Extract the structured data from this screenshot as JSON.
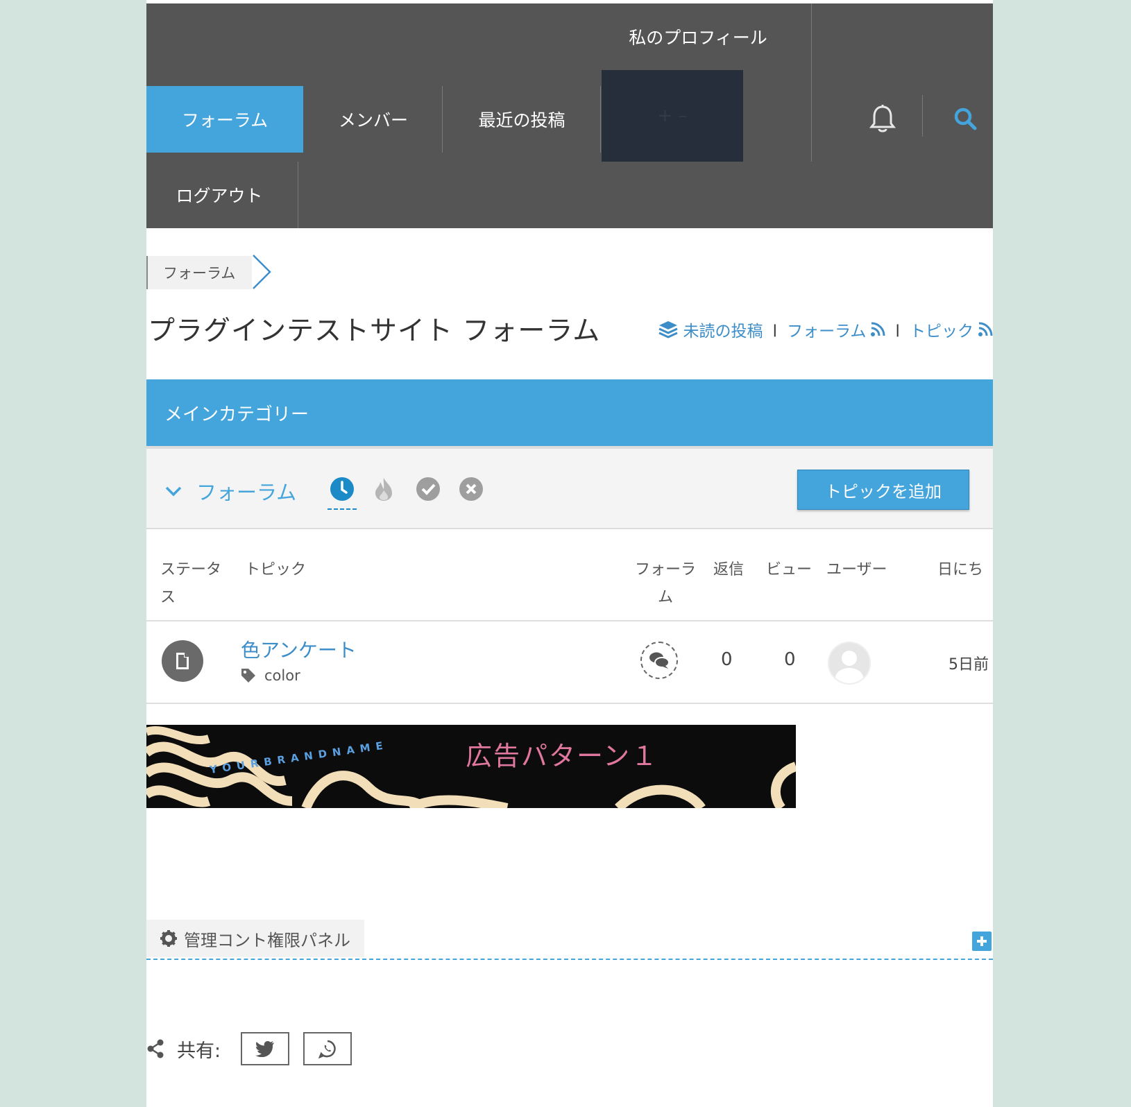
{
  "nav": {
    "items": [
      {
        "label": "私のプロフィール"
      },
      {
        "label": "フォーラム"
      },
      {
        "label": "メンバー"
      },
      {
        "label": "最近の投稿"
      },
      {
        "label": "ログアウト"
      }
    ],
    "hidden_item_label": "+ –",
    "bell_icon": "bell-icon",
    "search_icon": "search-icon"
  },
  "breadcrumb": {
    "label": "フォーラム"
  },
  "page_title": "プラグインテストサイト フォーラム",
  "links": {
    "unread": "未読の投稿",
    "forum_feed": "フォーラム",
    "topic_feed": "トピック",
    "separator": "|"
  },
  "category": {
    "title": "メインカテゴリー"
  },
  "toolbar": {
    "forum_label": "フォーラム",
    "add_topic_label": "トピックを追加",
    "filters": [
      "recent-icon",
      "hot-icon",
      "solved-icon",
      "unsolved-icon"
    ]
  },
  "table": {
    "headers": {
      "status_1": "ステータ",
      "status_2": "ス",
      "topic": "トピック",
      "forum_1": "フォーラ",
      "forum_2": "ム",
      "replies": "返信",
      "views": "ビュー",
      "user": "ユーザー",
      "date": "日にち"
    },
    "rows": [
      {
        "title": "色アンケート",
        "tag": "color",
        "replies": "0",
        "views": "0",
        "date": "5日前"
      }
    ]
  },
  "ad": {
    "text": "広告パターン１",
    "brand": "YOURBRANDNAME"
  },
  "admin": {
    "label": "管理コント権限パネル"
  },
  "share": {
    "label": "共有:"
  },
  "colors": {
    "accent": "#44a5dd",
    "nav_bg": "#555555",
    "page_bg": "#d3e4de",
    "link": "#3d8ec8"
  }
}
